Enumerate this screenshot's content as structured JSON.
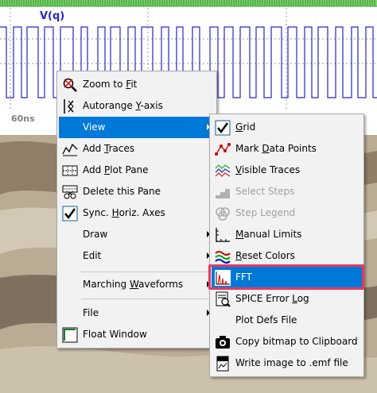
{
  "plot": {
    "trace_name": "V(q)",
    "trace_color": "#2626c8",
    "time_label": "60ns",
    "wave_levels": [
      1,
      0,
      1,
      0,
      1,
      0,
      1,
      0,
      1,
      0,
      1,
      0,
      1,
      0,
      1,
      0,
      1,
      0,
      1,
      0,
      1,
      0,
      1,
      0,
      1,
      0,
      1,
      0,
      1,
      0,
      1,
      0,
      1,
      0,
      1,
      0,
      1,
      0,
      1,
      0,
      1,
      0,
      1,
      0,
      1,
      0,
      1,
      0
    ]
  },
  "context_menu": {
    "items": [
      {
        "label": "Zoom to Fit",
        "icon": "zoom-to-fit-icon"
      },
      {
        "label": "Autorange Y-axis",
        "icon": "autorange-icon"
      },
      {
        "label": "View",
        "submenu": true
      },
      {
        "label": "Add Traces",
        "icon": "add-traces-icon"
      },
      {
        "label": "Add Plot Pane",
        "icon": "add-pane-icon"
      },
      {
        "label": "Delete this Pane",
        "icon": "delete-pane-icon"
      },
      {
        "label": "Sync. Horiz. Axes",
        "icon": "sync-axes-check-icon"
      },
      {
        "label": "Draw",
        "submenu": true
      },
      {
        "label": "Edit",
        "submenu": true
      },
      {
        "label": "Marching Waveforms",
        "submenu": true
      },
      {
        "label": "File",
        "submenu": true
      },
      {
        "label": "Float Window",
        "icon": "float-window-icon"
      }
    ]
  },
  "view_submenu": {
    "items": [
      {
        "label": "Grid",
        "icon": "grid-check-icon"
      },
      {
        "label": "Mark Data Points",
        "icon": "mark-data-points-icon"
      },
      {
        "label": "Visible Traces",
        "icon": "visible-traces-icon"
      },
      {
        "label": "Select Steps",
        "icon": "select-steps-icon",
        "disabled": true
      },
      {
        "label": "Step Legend",
        "icon": "step-legend-icon",
        "disabled": true
      },
      {
        "label": "Manual Limits",
        "icon": "manual-limits-icon"
      },
      {
        "label": "Reset Colors",
        "icon": "reset-colors-icon"
      },
      {
        "label": "FFT",
        "icon": "fft-icon",
        "selected": true
      },
      {
        "label": "SPICE Error Log",
        "icon": "error-log-icon"
      },
      {
        "label": "Plot Defs File"
      },
      {
        "label": "Copy bitmap to Clipboard",
        "icon": "copy-bitmap-icon"
      },
      {
        "label": "Write image to .emf file",
        "icon": "write-emf-icon"
      }
    ]
  },
  "colors": {
    "selection": "#0078d7",
    "highlight_border": "#e8375e",
    "menu_bg": "#f2f2f2"
  }
}
